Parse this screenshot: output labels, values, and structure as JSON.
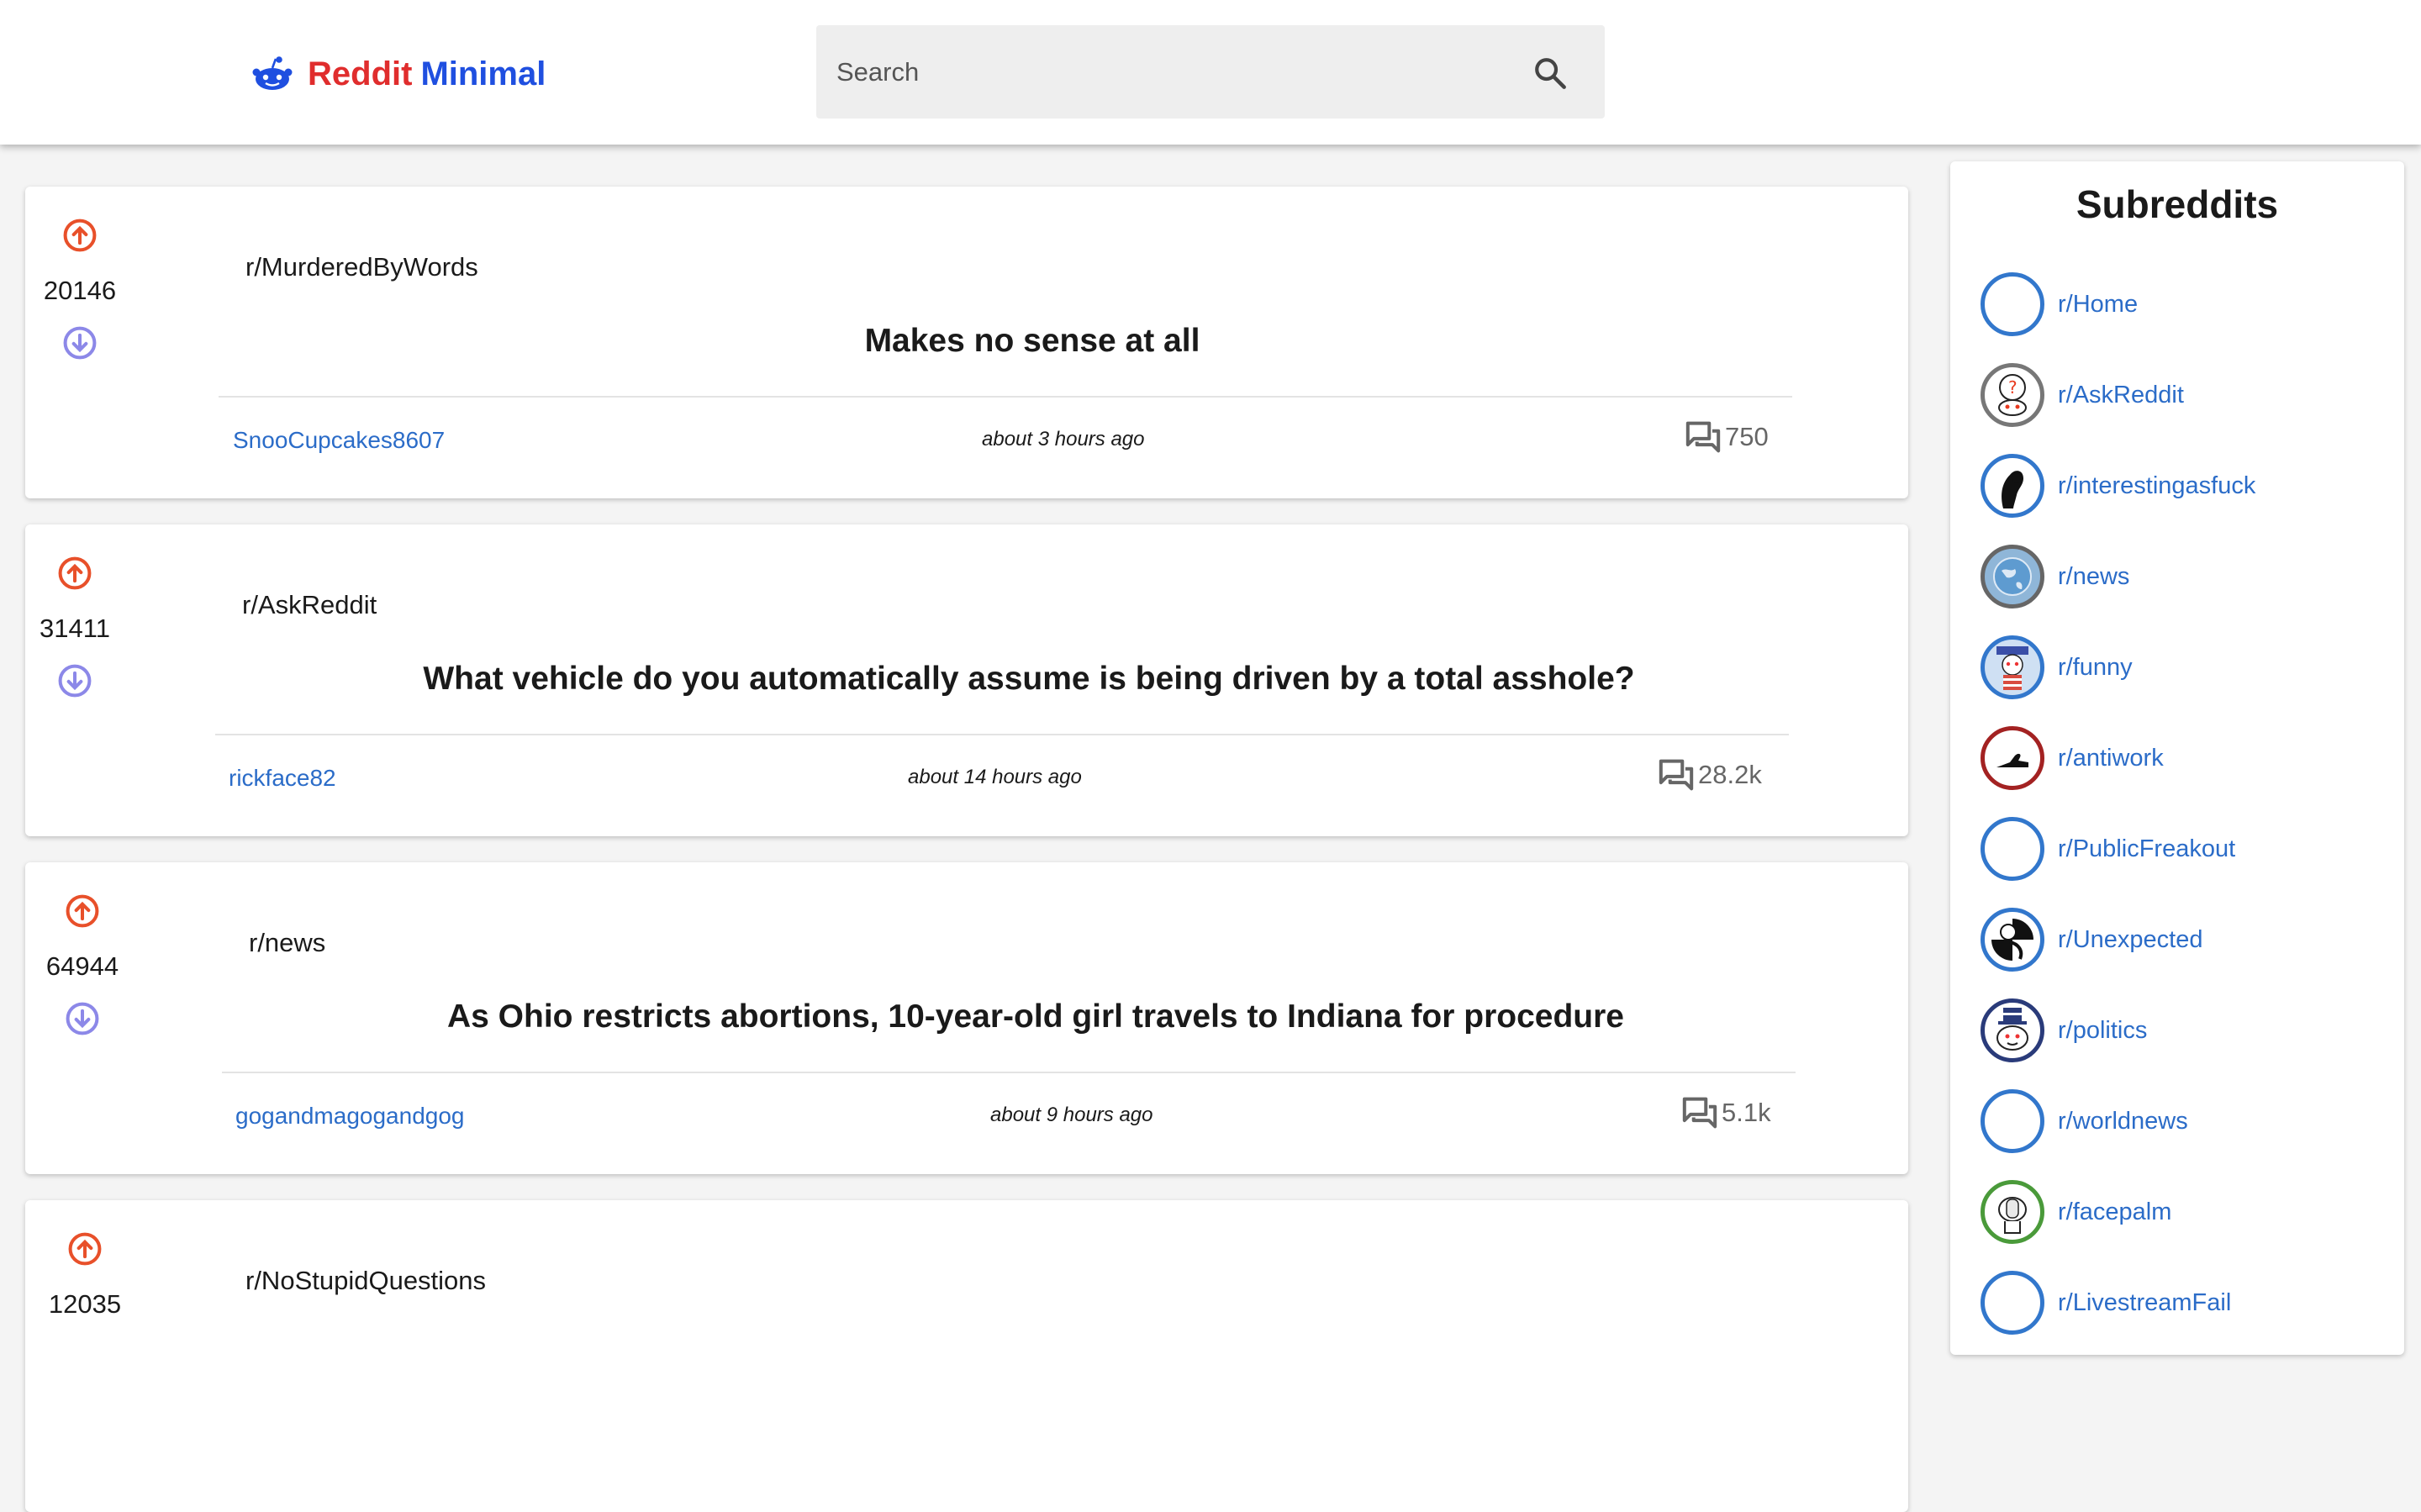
{
  "brand": {
    "part1": "Reddit",
    "part2": "Minimal"
  },
  "search": {
    "placeholder": "Search"
  },
  "colors": {
    "accent_blue": "#2b6cc8",
    "upvote": "#e8502a",
    "downvote": "#8c88e8",
    "brand_red": "#e02d2d",
    "brand_blue": "#1f4fe0"
  },
  "posts": [
    {
      "score": "20146",
      "subreddit": "r/MurderedByWords",
      "title": "Makes no sense at all",
      "author": "SnooCupcakes8607",
      "time": "about 3 hours ago",
      "comments": "750"
    },
    {
      "score": "31411",
      "subreddit": "r/AskReddit",
      "title": "What vehicle do you automatically assume is being driven by a total asshole?",
      "author": "rickface82",
      "time": "about 14 hours ago",
      "comments": "28.2k"
    },
    {
      "score": "64944",
      "subreddit": "r/news",
      "title": "As Ohio restricts abortions, 10-year-old girl travels to Indiana for procedure",
      "author": "gogandmagogandgog",
      "time": "about 9 hours ago",
      "comments": "5.1k"
    },
    {
      "score": "12035",
      "subreddit": "r/NoStupidQuestions",
      "title": "",
      "author": "",
      "time": "",
      "comments": ""
    }
  ],
  "sidebar": {
    "title": "Subreddits",
    "items": [
      {
        "label": "r/Home",
        "icon": "empty-avatar-icon",
        "ring": "#3277cc"
      },
      {
        "label": "r/AskReddit",
        "icon": "askreddit-avatar-icon",
        "ring": "#777777"
      },
      {
        "label": "r/interestingasfuck",
        "icon": "interestingasfuck-avatar-icon",
        "ring": "#3277cc"
      },
      {
        "label": "r/news",
        "icon": "news-globe-avatar-icon",
        "ring": "#666666"
      },
      {
        "label": "r/funny",
        "icon": "funny-avatar-icon",
        "ring": "#3277cc"
      },
      {
        "label": "r/antiwork",
        "icon": "antiwork-avatar-icon",
        "ring": "#a32222"
      },
      {
        "label": "r/PublicFreakout",
        "icon": "empty-avatar-icon",
        "ring": "#3277cc"
      },
      {
        "label": "r/Unexpected",
        "icon": "unexpected-avatar-icon",
        "ring": "#3277cc"
      },
      {
        "label": "r/politics",
        "icon": "politics-avatar-icon",
        "ring": "#2a3b7a"
      },
      {
        "label": "r/worldnews",
        "icon": "empty-avatar-icon",
        "ring": "#3277cc"
      },
      {
        "label": "r/facepalm",
        "icon": "facepalm-avatar-icon",
        "ring": "#4a9a3a"
      },
      {
        "label": "r/LivestreamFail",
        "icon": "empty-avatar-icon",
        "ring": "#3277cc"
      }
    ]
  }
}
